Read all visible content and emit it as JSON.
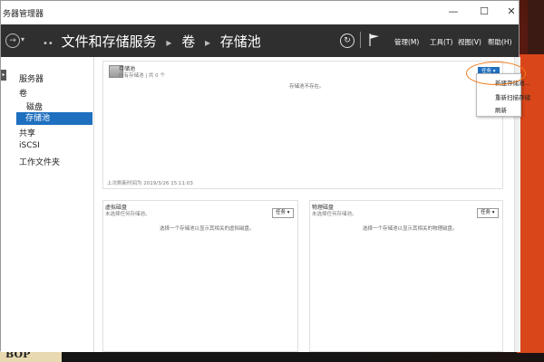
{
  "window": {
    "title": "务器管理器"
  },
  "header": {
    "breadcrumb": [
      "文件和存储服务",
      "卷",
      "存储池"
    ],
    "prefix": "••",
    "menus": [
      "管理(M)",
      "工具(T)",
      "视图(V)",
      "帮助(H)"
    ]
  },
  "sidebar": {
    "items": [
      {
        "label": "服务器"
      },
      {
        "label": "卷"
      },
      {
        "label": "磁盘"
      },
      {
        "label": "存储池"
      },
      {
        "label": "共享"
      },
      {
        "label": "iSCSI"
      },
      {
        "label": "工作文件夹"
      }
    ]
  },
  "storage_pools": {
    "title": "存储池",
    "subtitle": "所有存储池 | 共 0 个",
    "empty_message": "存储池不存在。",
    "last_refresh": "上次刷新时间为 2019/3/26 15:11:03",
    "tasks_label": "任务 ▾"
  },
  "task_menu": {
    "items": [
      "新建存储池...",
      "重新扫描存储",
      "刷新"
    ]
  },
  "virtual_disks": {
    "title": "虚拟磁盘",
    "subtitle": "未选择任何存储池。",
    "message": "选择一个存储池以显示其相关的虚拟磁盘。",
    "tasks_label": "任务 ▾"
  },
  "physical_disks": {
    "title": "物理磁盘",
    "subtitle": "未选择任何存储池。",
    "message": "选择一个存储池以显示其相关的物理磁盘。",
    "tasks_label": "任务 ▾"
  },
  "taskbar": {
    "logo_text": "BOP"
  }
}
